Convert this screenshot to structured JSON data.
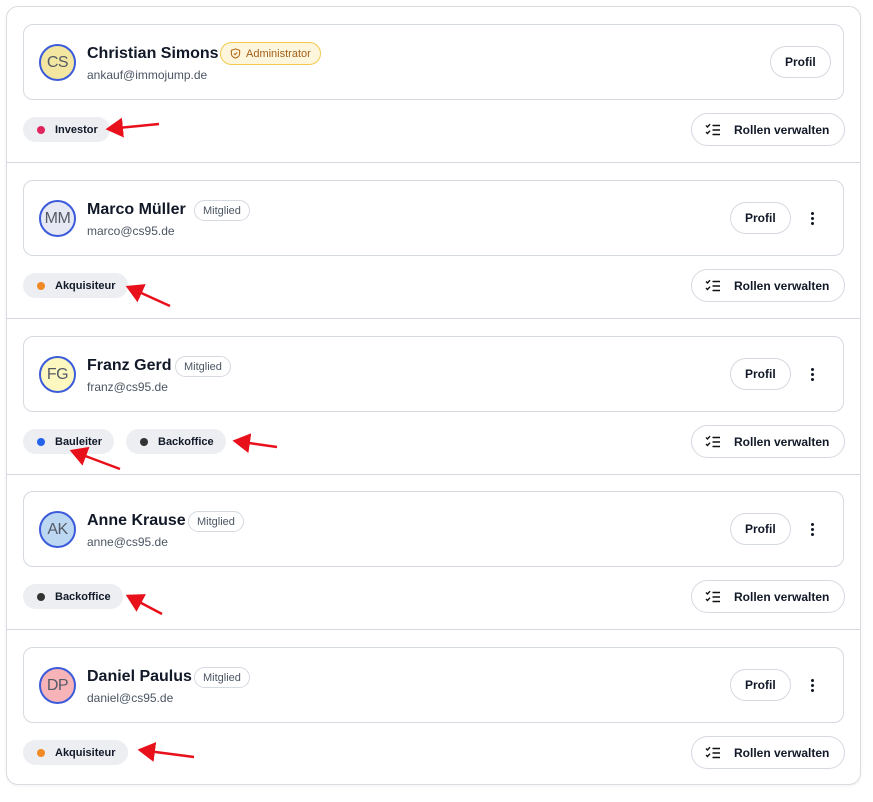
{
  "members": [
    {
      "initials": "CS",
      "name": "Christian Simons",
      "email": "ankauf@immojump.de",
      "role_badge": "Administrator",
      "avatar_bg": "#f2e6a0",
      "profile_label": "Profil",
      "roles": [
        {
          "label": "Investor",
          "color": "#e0245e"
        }
      ],
      "manage_roles_label": "Rollen verwalten"
    },
    {
      "initials": "MM",
      "name": "Marco Müller",
      "email": "marco@cs95.de",
      "role_badge": "Mitglied",
      "avatar_bg": "#e6e8f3",
      "profile_label": "Profil",
      "roles": [
        {
          "label": "Akquisiteur",
          "color": "#f08a24"
        }
      ],
      "manage_roles_label": "Rollen verwalten"
    },
    {
      "initials": "FG",
      "name": "Franz Gerd",
      "email": "franz@cs95.de",
      "role_badge": "Mitglied",
      "avatar_bg": "#fdf7c0",
      "profile_label": "Profil",
      "roles": [
        {
          "label": "Bauleiter",
          "color": "#2563eb"
        },
        {
          "label": "Backoffice",
          "color": "#333333"
        }
      ],
      "manage_roles_label": "Rollen verwalten"
    },
    {
      "initials": "AK",
      "name": "Anne Krause",
      "email": "anne@cs95.de",
      "role_badge": "Mitglied",
      "avatar_bg": "#bcd7f2",
      "profile_label": "Profil",
      "roles": [
        {
          "label": "Backoffice",
          "color": "#333333"
        }
      ],
      "manage_roles_label": "Rollen verwalten"
    },
    {
      "initials": "DP",
      "name": "Daniel Paulus",
      "email": "daniel@cs95.de",
      "role_badge": "Mitglied",
      "avatar_bg": "#f7b4b8",
      "profile_label": "Profil",
      "roles": [
        {
          "label": "Akquisiteur",
          "color": "#f08a24"
        }
      ],
      "manage_roles_label": "Rollen verwalten"
    }
  ],
  "icons": {
    "admin_badge": "shield-icon",
    "manage_roles": "checklist-icon",
    "more": "kebab-menu-icon",
    "annotation": "red-arrow"
  },
  "colors": {
    "arrow": "#e8101a",
    "avatar_ring": "#3b5bdb",
    "admin_badge_bg": "#fef6dc",
    "admin_badge_border": "#f2c94c"
  }
}
